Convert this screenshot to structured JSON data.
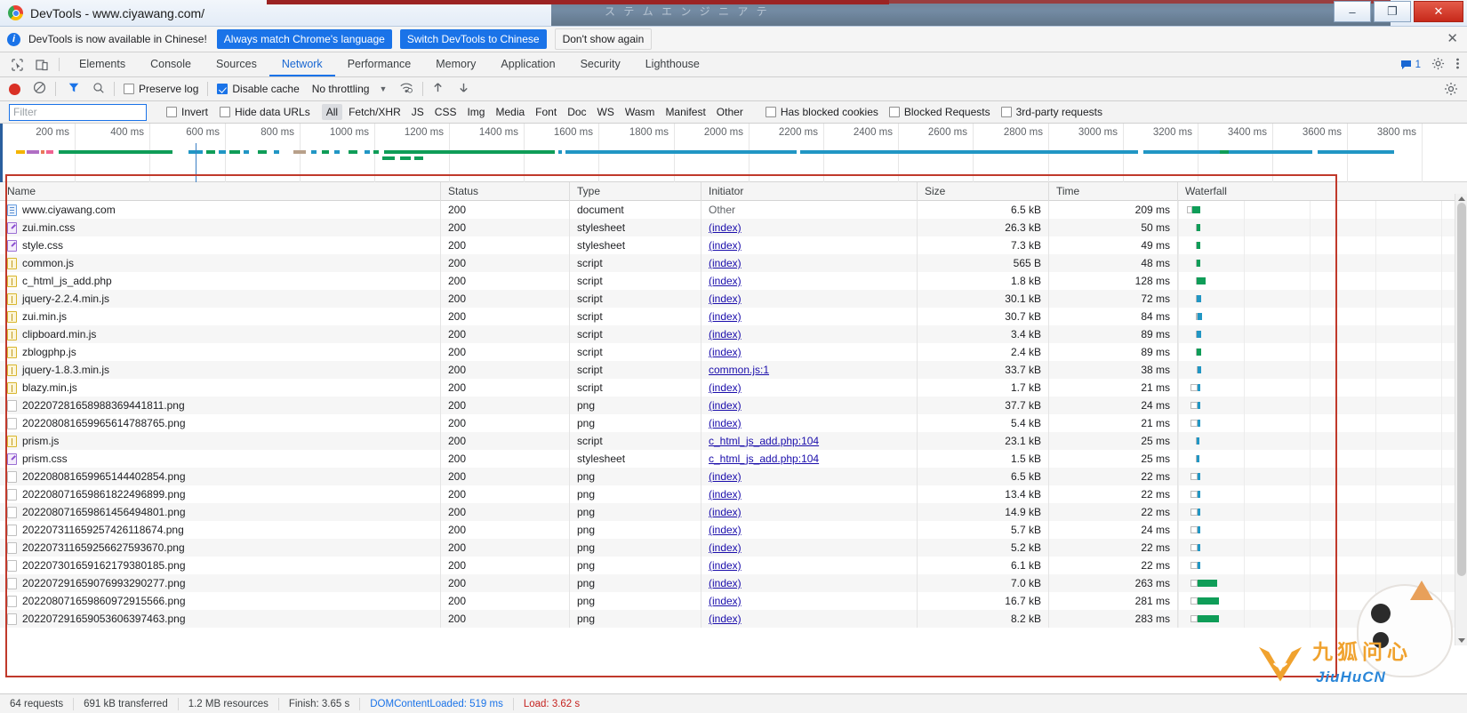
{
  "window": {
    "title": "DevTools - www.ciyawang.com/",
    "logo_icon": "chrome-logo-icon",
    "minimize_label": "–",
    "maximize_label": "❐",
    "close_label": "✕",
    "bg_strip_text": "ス テ ム エ ン ジ ニ ア テ"
  },
  "banner": {
    "info_icon": "info-icon",
    "message": "DevTools is now available in Chinese!",
    "primary_button": "Always match Chrome's language",
    "secondary_button": "Switch DevTools to Chinese",
    "dismiss_button": "Don't show again",
    "close_icon": "close-icon"
  },
  "tabbar": {
    "inspect_icon": "inspect-element-icon",
    "device_icon": "device-toolbar-icon",
    "tabs": [
      {
        "label": "Elements",
        "active": false
      },
      {
        "label": "Console",
        "active": false
      },
      {
        "label": "Sources",
        "active": false
      },
      {
        "label": "Network",
        "active": true
      },
      {
        "label": "Performance",
        "active": false
      },
      {
        "label": "Memory",
        "active": false
      },
      {
        "label": "Application",
        "active": false
      },
      {
        "label": "Security",
        "active": false
      },
      {
        "label": "Lighthouse",
        "active": false
      }
    ],
    "message_count": "1",
    "message_icon": "message-bubble-icon",
    "settings_icon": "gear-icon",
    "more_icon": "more-vertical-icon"
  },
  "controls": {
    "record_icon": "record-button-icon",
    "clear_icon": "clear-circle-slash-icon",
    "filter_icon": "filter-funnel-icon",
    "search_icon": "search-icon",
    "preserve_log_label": "Preserve log",
    "preserve_log_checked": false,
    "disable_cache_label": "Disable cache",
    "disable_cache_checked": true,
    "throttling_value": "No throttling",
    "throttling_caret_icon": "chevron-down-icon",
    "wifi_icon": "network-conditions-icon",
    "import_icon": "import-har-icon",
    "export_icon": "export-har-icon",
    "settings_icon": "gear-icon"
  },
  "filterbar": {
    "filter_placeholder": "Filter",
    "filter_value": "",
    "invert_label": "Invert",
    "invert_checked": false,
    "hide_data_urls_label": "Hide data URLs",
    "hide_data_urls_checked": false,
    "types": [
      "All",
      "Fetch/XHR",
      "JS",
      "CSS",
      "Img",
      "Media",
      "Font",
      "Doc",
      "WS",
      "Wasm",
      "Manifest",
      "Other"
    ],
    "active_type": "All",
    "has_blocked_cookies_label": "Has blocked cookies",
    "has_blocked_cookies_checked": false,
    "blocked_requests_label": "Blocked Requests",
    "blocked_requests_checked": false,
    "third_party_label": "3rd-party requests",
    "third_party_checked": false
  },
  "overview": {
    "ticks": [
      "200 ms",
      "400 ms",
      "600 ms",
      "800 ms",
      "1000 ms",
      "1200 ms",
      "1400 ms",
      "1600 ms",
      "1800 ms",
      "2000 ms",
      "2200 ms",
      "2400 ms",
      "2600 ms",
      "2800 ms",
      "3000 ms",
      "3200 ms",
      "3400 ms",
      "3600 ms",
      "3800 ms"
    ]
  },
  "table": {
    "columns": [
      "Name",
      "Status",
      "Type",
      "Initiator",
      "Size",
      "Time",
      "Waterfall"
    ],
    "rows": [
      {
        "icon": "doc",
        "name": "www.ciyawang.com",
        "status": "200",
        "type": "document",
        "initiator": "Other",
        "initiator_link": false,
        "size": "6.5 kB",
        "time": "209 ms",
        "wf_start": 10,
        "wf_wait": 6,
        "wf_dl": 9,
        "wf_color": "#0f9d58"
      },
      {
        "icon": "css",
        "name": "zui.min.css",
        "status": "200",
        "type": "stylesheet",
        "initiator": "(index)",
        "initiator_link": true,
        "size": "26.3 kB",
        "time": "50 ms",
        "wf_start": 20,
        "wf_wait": 1,
        "wf_dl": 4,
        "wf_color": "#0f9d58"
      },
      {
        "icon": "css",
        "name": "style.css",
        "status": "200",
        "type": "stylesheet",
        "initiator": "(index)",
        "initiator_link": true,
        "size": "7.3 kB",
        "time": "49 ms",
        "wf_start": 20,
        "wf_wait": 1,
        "wf_dl": 4,
        "wf_color": "#0f9d58"
      },
      {
        "icon": "js",
        "name": "common.js",
        "status": "200",
        "type": "script",
        "initiator": "(index)",
        "initiator_link": true,
        "size": "565 B",
        "time": "48 ms",
        "wf_start": 20,
        "wf_wait": 1,
        "wf_dl": 4,
        "wf_color": "#0f9d58"
      },
      {
        "icon": "js",
        "name": "c_html_js_add.php",
        "status": "200",
        "type": "script",
        "initiator": "(index)",
        "initiator_link": true,
        "size": "1.8 kB",
        "time": "128 ms",
        "wf_start": 20,
        "wf_wait": 1,
        "wf_dl": 10,
        "wf_color": "#0f9d58"
      },
      {
        "icon": "js",
        "name": "jquery-2.2.4.min.js",
        "status": "200",
        "type": "script",
        "initiator": "(index)",
        "initiator_link": true,
        "size": "30.1 kB",
        "time": "72 ms",
        "wf_start": 20,
        "wf_wait": 1,
        "wf_dl": 5,
        "wf_color": "#2196c4"
      },
      {
        "icon": "js",
        "name": "zui.min.js",
        "status": "200",
        "type": "script",
        "initiator": "(index)",
        "initiator_link": true,
        "size": "30.7 kB",
        "time": "84 ms",
        "wf_start": 20,
        "wf_wait": 2,
        "wf_dl": 5,
        "wf_color": "#2196c4"
      },
      {
        "icon": "js",
        "name": "clipboard.min.js",
        "status": "200",
        "type": "script",
        "initiator": "(index)",
        "initiator_link": true,
        "size": "3.4 kB",
        "time": "89 ms",
        "wf_start": 20,
        "wf_wait": 1,
        "wf_dl": 5,
        "wf_color": "#2196c4"
      },
      {
        "icon": "js",
        "name": "zblogphp.js",
        "status": "200",
        "type": "script",
        "initiator": "(index)",
        "initiator_link": true,
        "size": "2.4 kB",
        "time": "89 ms",
        "wf_start": 20,
        "wf_wait": 1,
        "wf_dl": 5,
        "wf_color": "#0f9d58"
      },
      {
        "icon": "js",
        "name": "jquery-1.8.3.min.js",
        "status": "200",
        "type": "script",
        "initiator": "common.js:1",
        "initiator_link": true,
        "size": "33.7 kB",
        "time": "38 ms",
        "wf_start": 21,
        "wf_wait": 1,
        "wf_dl": 4,
        "wf_color": "#2196c4"
      },
      {
        "icon": "js",
        "name": "blazy.min.js",
        "status": "200",
        "type": "script",
        "initiator": "(index)",
        "initiator_link": true,
        "size": "1.7 kB",
        "time": "21 ms",
        "wf_start": 14,
        "wf_wait": 8,
        "wf_dl": 3,
        "wf_color": "#2196c4"
      },
      {
        "icon": "img",
        "name": "20220728165898836944181​1.png",
        "status": "200",
        "type": "png",
        "initiator": "(index)",
        "initiator_link": true,
        "size": "37.7 kB",
        "time": "24 ms",
        "wf_start": 14,
        "wf_wait": 8,
        "wf_dl": 3,
        "wf_color": "#2196c4"
      },
      {
        "icon": "img",
        "name": "20220808165996561478876​5.png",
        "status": "200",
        "type": "png",
        "initiator": "(index)",
        "initiator_link": true,
        "size": "5.4 kB",
        "time": "21 ms",
        "wf_start": 14,
        "wf_wait": 8,
        "wf_dl": 3,
        "wf_color": "#2196c4"
      },
      {
        "icon": "js",
        "name": "prism.js",
        "status": "200",
        "type": "script",
        "initiator": "c_html_js_add.php:104",
        "initiator_link": true,
        "size": "23.1 kB",
        "time": "25 ms",
        "wf_start": 20,
        "wf_wait": 1,
        "wf_dl": 3,
        "wf_color": "#2196c4"
      },
      {
        "icon": "css",
        "name": "prism.css",
        "status": "200",
        "type": "stylesheet",
        "initiator": "c_html_js_add.php:104",
        "initiator_link": true,
        "size": "1.5 kB",
        "time": "25 ms",
        "wf_start": 20,
        "wf_wait": 1,
        "wf_dl": 3,
        "wf_color": "#2196c4"
      },
      {
        "icon": "img",
        "name": "20220808165996514440285​4.png",
        "status": "200",
        "type": "png",
        "initiator": "(index)",
        "initiator_link": true,
        "size": "6.5 kB",
        "time": "22 ms",
        "wf_start": 14,
        "wf_wait": 8,
        "wf_dl": 3,
        "wf_color": "#2196c4"
      },
      {
        "icon": "img",
        "name": "20220807165986182249689​9.png",
        "status": "200",
        "type": "png",
        "initiator": "(index)",
        "initiator_link": true,
        "size": "13.4 kB",
        "time": "22 ms",
        "wf_start": 14,
        "wf_wait": 8,
        "wf_dl": 3,
        "wf_color": "#2196c4"
      },
      {
        "icon": "img",
        "name": "20220807165986145649480​1.png",
        "status": "200",
        "type": "png",
        "initiator": "(index)",
        "initiator_link": true,
        "size": "14.9 kB",
        "time": "22 ms",
        "wf_start": 14,
        "wf_wait": 8,
        "wf_dl": 3,
        "wf_color": "#2196c4"
      },
      {
        "icon": "img",
        "name": "20220731165925742611867​4.png",
        "status": "200",
        "type": "png",
        "initiator": "(index)",
        "initiator_link": true,
        "size": "5.7 kB",
        "time": "24 ms",
        "wf_start": 14,
        "wf_wait": 8,
        "wf_dl": 3,
        "wf_color": "#2196c4"
      },
      {
        "icon": "img",
        "name": "20220731165925662759367​0.png",
        "status": "200",
        "type": "png",
        "initiator": "(index)",
        "initiator_link": true,
        "size": "5.2 kB",
        "time": "22 ms",
        "wf_start": 14,
        "wf_wait": 8,
        "wf_dl": 3,
        "wf_color": "#2196c4"
      },
      {
        "icon": "img",
        "name": "20220730165916217938018​5.png",
        "status": "200",
        "type": "png",
        "initiator": "(index)",
        "initiator_link": true,
        "size": "6.1 kB",
        "time": "22 ms",
        "wf_start": 14,
        "wf_wait": 8,
        "wf_dl": 3,
        "wf_color": "#2196c4"
      },
      {
        "icon": "img",
        "name": "20220729165907699329027​7.png",
        "status": "200",
        "type": "png",
        "initiator": "(index)",
        "initiator_link": true,
        "size": "7.0 kB",
        "time": "263 ms",
        "wf_start": 14,
        "wf_wait": 8,
        "wf_dl": 22,
        "wf_color": "#0f9d58"
      },
      {
        "icon": "img",
        "name": "20220807165986097291556​6.png",
        "status": "200",
        "type": "png",
        "initiator": "(index)",
        "initiator_link": true,
        "size": "16.7 kB",
        "time": "281 ms",
        "wf_start": 14,
        "wf_wait": 8,
        "wf_dl": 24,
        "wf_color": "#0f9d58"
      },
      {
        "icon": "img",
        "name": "20220729165905360639746​3.png",
        "status": "200",
        "type": "png",
        "initiator": "(index)",
        "initiator_link": true,
        "size": "8.2 kB",
        "time": "283 ms",
        "wf_start": 14,
        "wf_wait": 8,
        "wf_dl": 24,
        "wf_color": "#0f9d58"
      }
    ]
  },
  "footer": {
    "requests": "64 requests",
    "transferred": "691 kB transferred",
    "resources": "1.2 MB resources",
    "finish": "Finish: 3.65 s",
    "dom_content_loaded": "DOMContentLoaded: 519 ms",
    "load": "Load: 3.62 s"
  },
  "watermark": {
    "text_cn": "九狐问心",
    "text_en": "JiuHuCN",
    "fox_icon": "fox-logo-icon"
  },
  "colors": {
    "accent": "#1a73e8",
    "link": "#1a0dab",
    "download_green": "#0f9d58",
    "waiting_blue": "#2196c4",
    "selection_red": "#c0392b",
    "status_red": "#c5221f"
  }
}
